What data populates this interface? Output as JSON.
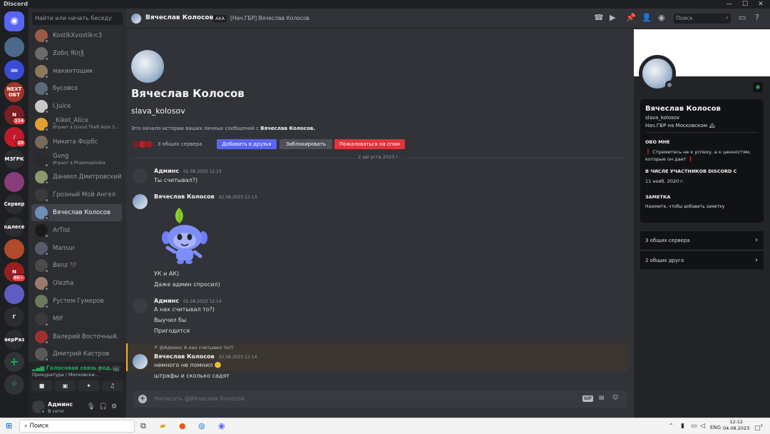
{
  "window": {
    "title": "Discord",
    "controls": {
      "minimize": "—",
      "maximize": "☐",
      "close": "✕"
    }
  },
  "servers": [
    {
      "label": "",
      "icon": "discord-home-icon",
      "color": "#5865f2"
    },
    {
      "label": "",
      "icon": "server-avatar",
      "color": "#4b6a8a"
    },
    {
      "label": "",
      "icon": "folder-icon",
      "color": "#3a4bd6"
    },
    {
      "label": "NEXT ОБТ",
      "badge": "",
      "color": "#a0352b"
    },
    {
      "label": "N",
      "badge": "114",
      "color": "#7a1f24"
    },
    {
      "label": "/",
      "badge": "10",
      "color": "#c11a2b"
    },
    {
      "label": "МЗГРК",
      "badge": "",
      "color": "#2b2d31"
    },
    {
      "label": "",
      "badge": "",
      "color": "#8a3b7a"
    },
    {
      "label": "Сервер",
      "badge": "",
      "color": "#2b2d31"
    },
    {
      "label": "подлесер",
      "badge": "",
      "color": "#2b2d31"
    },
    {
      "label": "",
      "badge": "",
      "color": "#b04a2b"
    },
    {
      "label": "N",
      "badge": "9К+",
      "color": "#9a1f20"
    },
    {
      "label": "",
      "badge": "",
      "color": "#5f5cc2"
    },
    {
      "label": "Г",
      "badge": "",
      "color": "#2b2d31"
    },
    {
      "label": "рверРазв",
      "badge": "",
      "color": "#2b2d31"
    },
    {
      "label": "+",
      "badge": "",
      "color": "#313338"
    },
    {
      "label": "",
      "icon": "compass-icon",
      "color": "#313338"
    }
  ],
  "dm_search": {
    "placeholder": "Найти или начать беседу"
  },
  "dms": [
    {
      "name": "KostikXvostik<3",
      "sub": "",
      "color": "#9a5b4a"
    },
    {
      "name": "Ƶσɓη Яίη℥",
      "sub": "",
      "color": "#6b6b6b"
    },
    {
      "name": "макинтошик",
      "sub": "",
      "color": "#8a7a5a"
    },
    {
      "name": "бусовоз",
      "sub": "",
      "color": "#5a6a7a"
    },
    {
      "name": "I.Juice",
      "sub": "",
      "color": "#c9c9c9"
    },
    {
      "name": "_Kiket_Alice",
      "sub": "Играет в Grand Theft Auto S...",
      "color": "#e0a030"
    },
    {
      "name": "Никита Форбс",
      "sub": "",
      "color": "#7a6a5a"
    },
    {
      "name": "Gvng",
      "sub": "Играет в Phasmophobia",
      "color": "#2a2a2a"
    },
    {
      "name": "Даниил Дмитровский",
      "sub": "",
      "color": "#8a9a6a"
    },
    {
      "name": "Грозный Мой Ангел",
      "sub": "",
      "color": "#3a3a3a"
    },
    {
      "name": "Вячеслав Колосов",
      "sub": "",
      "color": "#6d8eb6"
    },
    {
      "name": "ArTist",
      "sub": "",
      "color": "#1a1a1a"
    },
    {
      "name": "Mansur",
      "sub": "",
      "color": "#5a5a6a"
    },
    {
      "name": "Benz 🖤",
      "sub": "",
      "color": "#4a4a4a"
    },
    {
      "name": "Olezha",
      "sub": "",
      "color": "#9a7a6a"
    },
    {
      "name": "Рустем Гумеров",
      "sub": "",
      "color": "#6a7a5a"
    },
    {
      "name": "MIF",
      "sub": "",
      "color": "#3a3a3a"
    },
    {
      "name": "Валерий Восточный.",
      "sub": "",
      "color": "#a03030"
    },
    {
      "name": "Дмитрий Кастров",
      "sub": "",
      "color": "#5a5a5a"
    }
  ],
  "voice": {
    "title": "Голосовая связь под...",
    "subtitle": "Прокуратура / Московски..."
  },
  "user": {
    "name": "Админс",
    "status": "В сети"
  },
  "topbar": {
    "name": "Вячеслав Колосов",
    "aka": "AKA",
    "aka_text": "[Нач.ГБР] Вячеслав Колосов",
    "search": "Поиск"
  },
  "intro": {
    "title": "Вячеслав Колосов",
    "username": "slava_kolosov",
    "text_pre": "Это начало истории ваших личных сообщений с ",
    "text_name": "Вячеслав Колосов.",
    "mutual": "3 общих сервера",
    "add_friend": "Добавить в друзья",
    "block": "Заблокировать",
    "report": "Пожаловаться на спам"
  },
  "date_divider": "2 августа 2023 г.",
  "messages": [
    {
      "author": "Админс",
      "time": "02.08.2023 12:13",
      "lines": [
        "Ты считывал?)"
      ]
    },
    {
      "author": "Вячеслав Колосов",
      "time": "02.08.2023 12:13",
      "lines": [
        "УК и АК)",
        "Даже админ спросил)"
      ]
    },
    {
      "author": "Админс",
      "time": "02.08.2023 12:14",
      "lines": [
        "А нах считывал то?)",
        "Выучил бы",
        "Пригодится"
      ]
    },
    {
      "author": "Вячеслав Колосов",
      "time": "02.08.2023 12:14",
      "reply": "@Админс А нах считывал то?)",
      "lines": [
        "немного не помнил 🙂",
        "штрафы и сколько садят"
      ]
    }
  ],
  "composer": {
    "placeholder": "Написать @Вячеслав Колосов",
    "gif": "GIF"
  },
  "profile": {
    "name": "Вячеслав Колосов",
    "username": "slava_kolosov",
    "status": "Нач.ГБР на Московском 🏔",
    "about_title": "ОБО МНЕ",
    "about_text": "❗ Стремитесь не к успеху, а к ценностям, которые он дает ❗",
    "member_title": "В ЧИСЛЕ УЧАСТНИКОВ DISCORD С",
    "member_since": "11 нояб. 2020 г.",
    "note_title": "ЗАМЕТКА",
    "note_placeholder": "Нажмите, чтобы добавить заметку",
    "mutual_servers": "3 общих сервера",
    "mutual_friends": "2 общих друга"
  },
  "taskbar": {
    "search": "Поиск",
    "lang": "ENG",
    "time": "12:12",
    "date": "04.08.2023",
    "notif": "2"
  }
}
